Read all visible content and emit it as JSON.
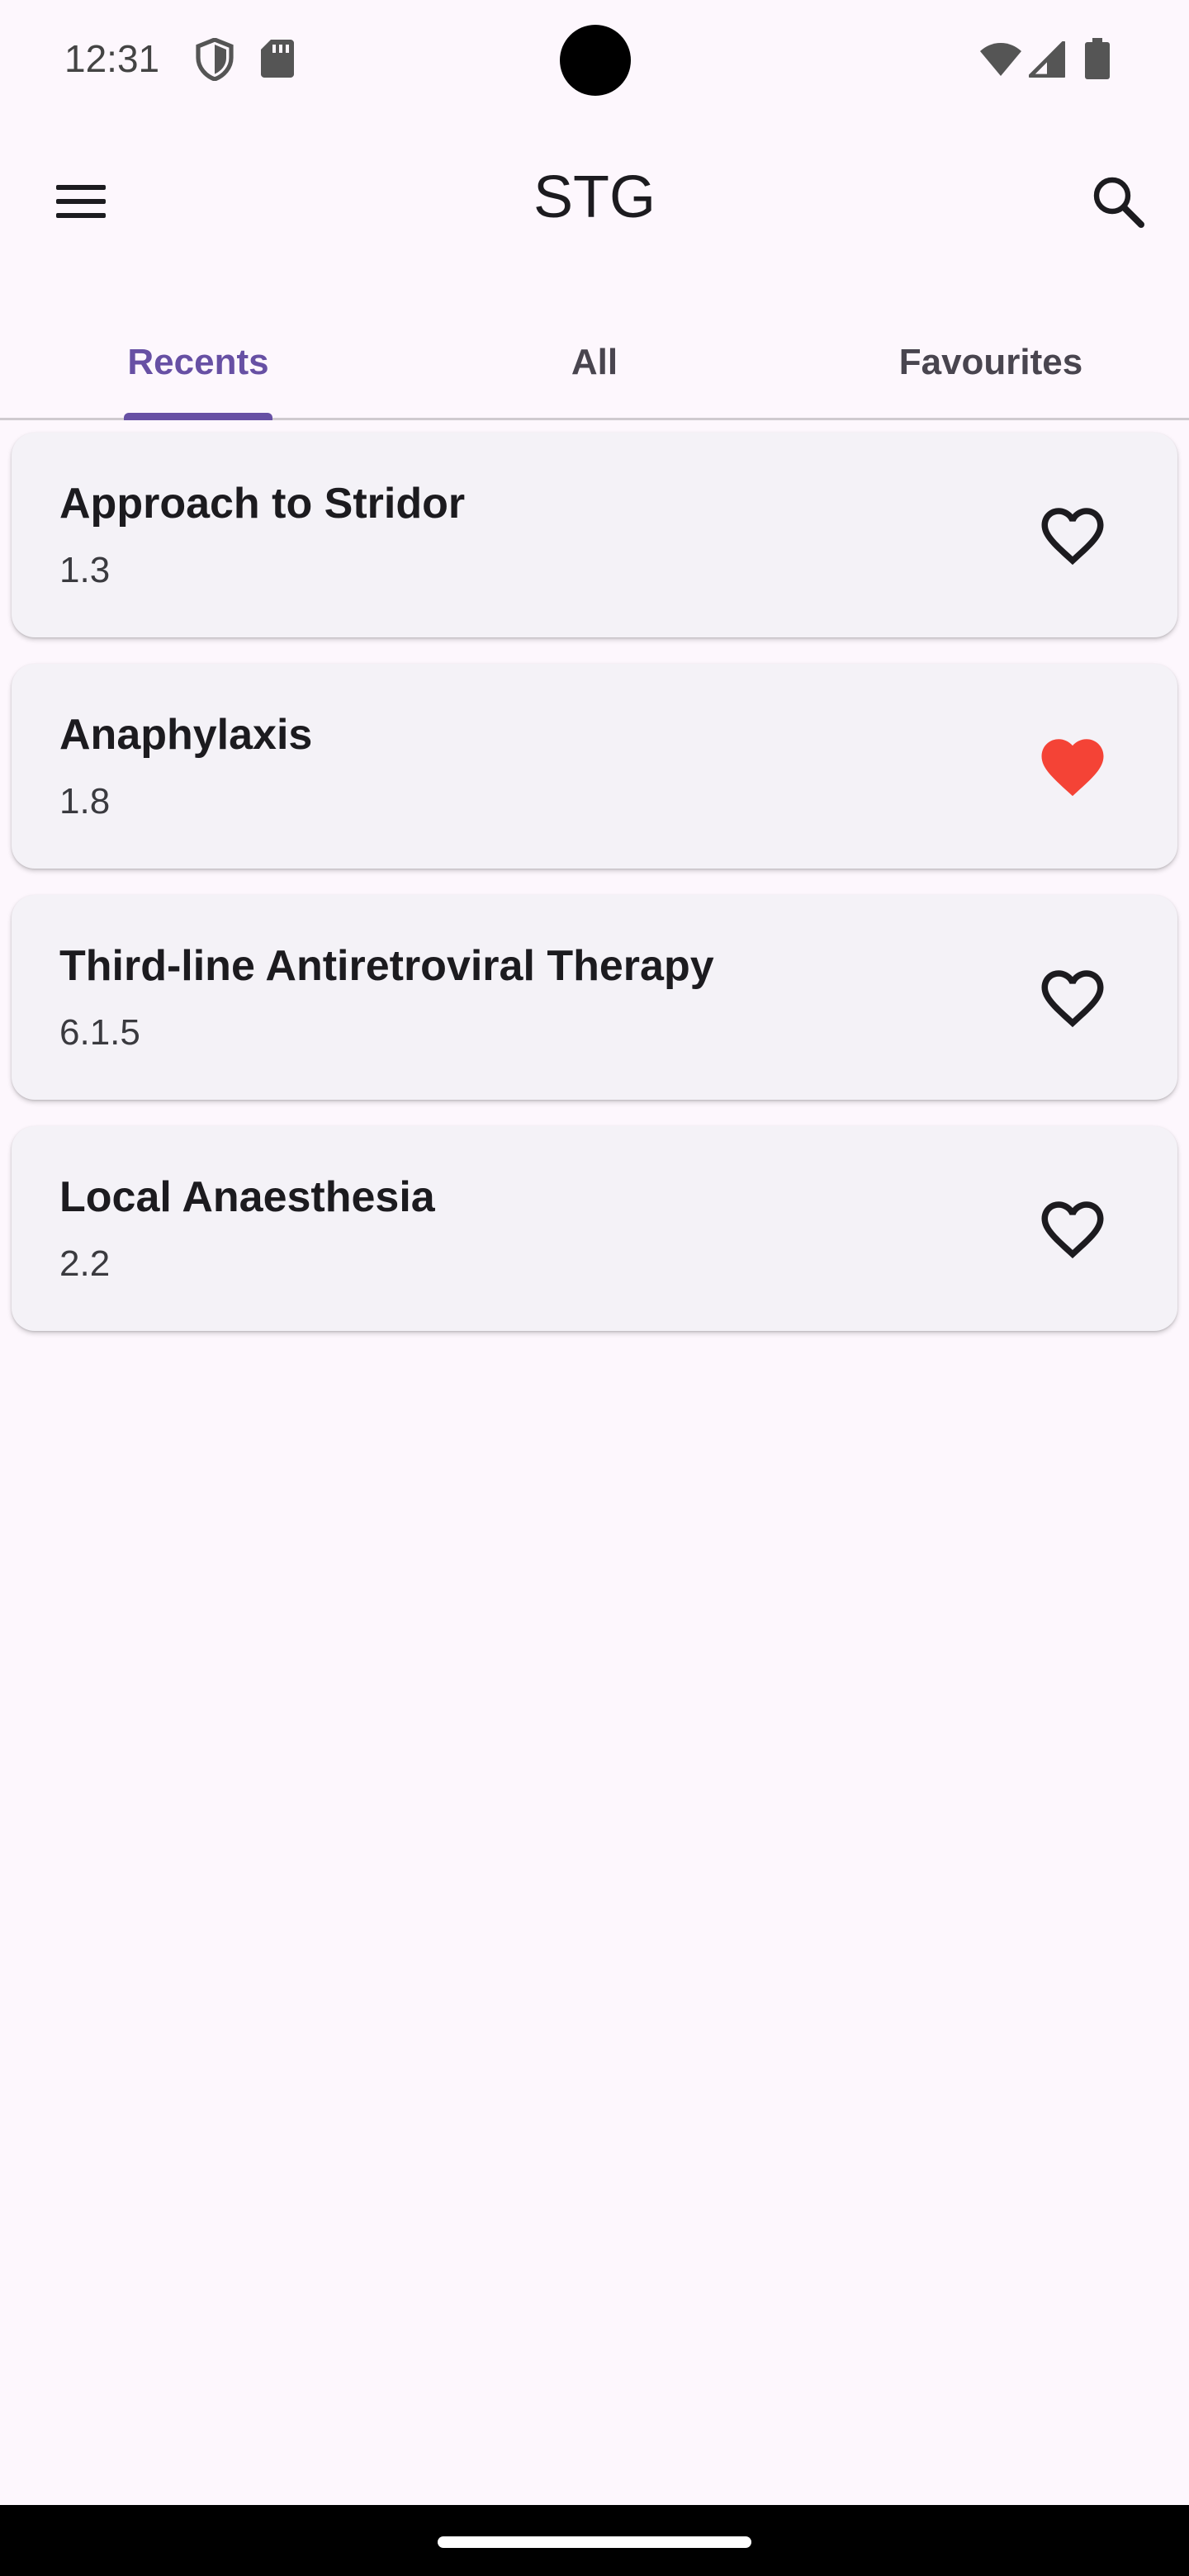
{
  "status": {
    "time": "12:31",
    "icons": [
      "shield-icon",
      "sd-card-icon",
      "wifi-icon",
      "signal-icon",
      "battery-icon"
    ]
  },
  "appbar": {
    "title": "STG",
    "menu_icon": "menu-icon",
    "search_icon": "search-icon"
  },
  "tabs": [
    {
      "label": "Recents",
      "active": true
    },
    {
      "label": "All",
      "active": false
    },
    {
      "label": "Favourites",
      "active": false
    }
  ],
  "items": [
    {
      "title": "Approach to Stridor",
      "code": "1.3",
      "favourite": false
    },
    {
      "title": "Anaphylaxis",
      "code": "1.8",
      "favourite": true
    },
    {
      "title": "Third-line Antiretroviral Therapy",
      "code": "6.1.5",
      "favourite": false
    },
    {
      "title": "Local Anaesthesia",
      "code": "2.2",
      "favourite": false
    }
  ],
  "colors": {
    "accent": "#6750A4",
    "favourite": "#F44336",
    "background": "#FDF7FD",
    "card": "#F4F2F7"
  }
}
